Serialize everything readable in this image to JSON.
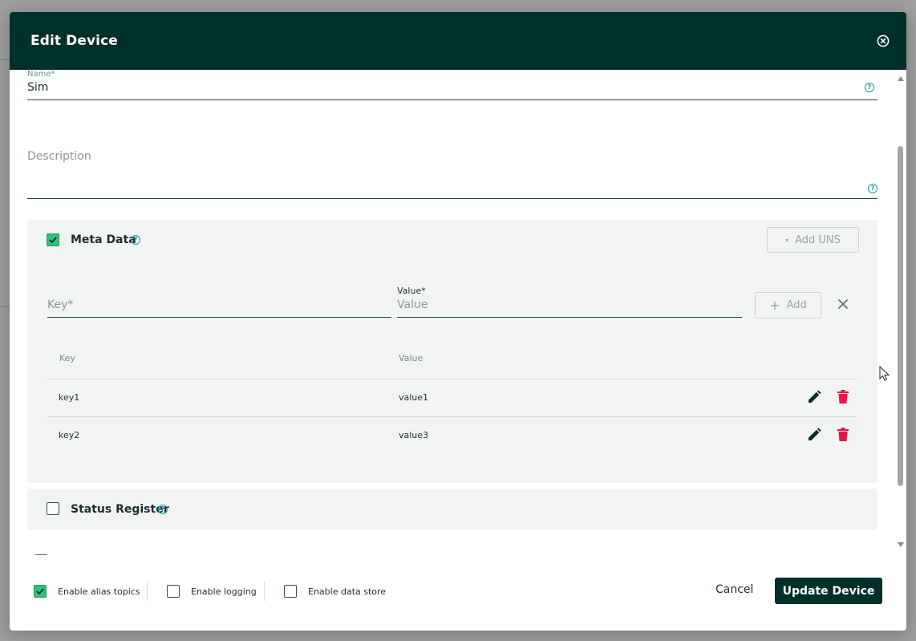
{
  "dialog": {
    "title": "Edit Device",
    "close_icon": "close-circle-icon"
  },
  "form": {
    "name_label": "Name*",
    "name_value": "Sim",
    "description_placeholder": "Description"
  },
  "meta_data": {
    "title": "Meta Data",
    "checked": true,
    "add_uns_label": "Add UNS",
    "key_placeholder": "Key*",
    "value_label": "Value*",
    "value_placeholder": "Value",
    "add_label": "Add",
    "table": {
      "columns": [
        "Key",
        "Value"
      ],
      "rows": [
        {
          "key": "key1",
          "value": "value1"
        },
        {
          "key": "key2",
          "value": "value3"
        }
      ]
    }
  },
  "status_register": {
    "title": "Status Register",
    "checked": false
  },
  "footer": {
    "options": [
      {
        "label": "Enable alias topics",
        "checked": true
      },
      {
        "label": "Enable logging",
        "checked": false
      },
      {
        "label": "Enable data store",
        "checked": false
      }
    ],
    "cancel_label": "Cancel",
    "submit_label": "Update Device"
  },
  "colors": {
    "header_bg": "#00302a",
    "checkbox_checked": "#2ec27e",
    "delete_red": "#e8174a",
    "help_teal": "#1a9aa8",
    "panel_bg": "#f2f4f4"
  }
}
